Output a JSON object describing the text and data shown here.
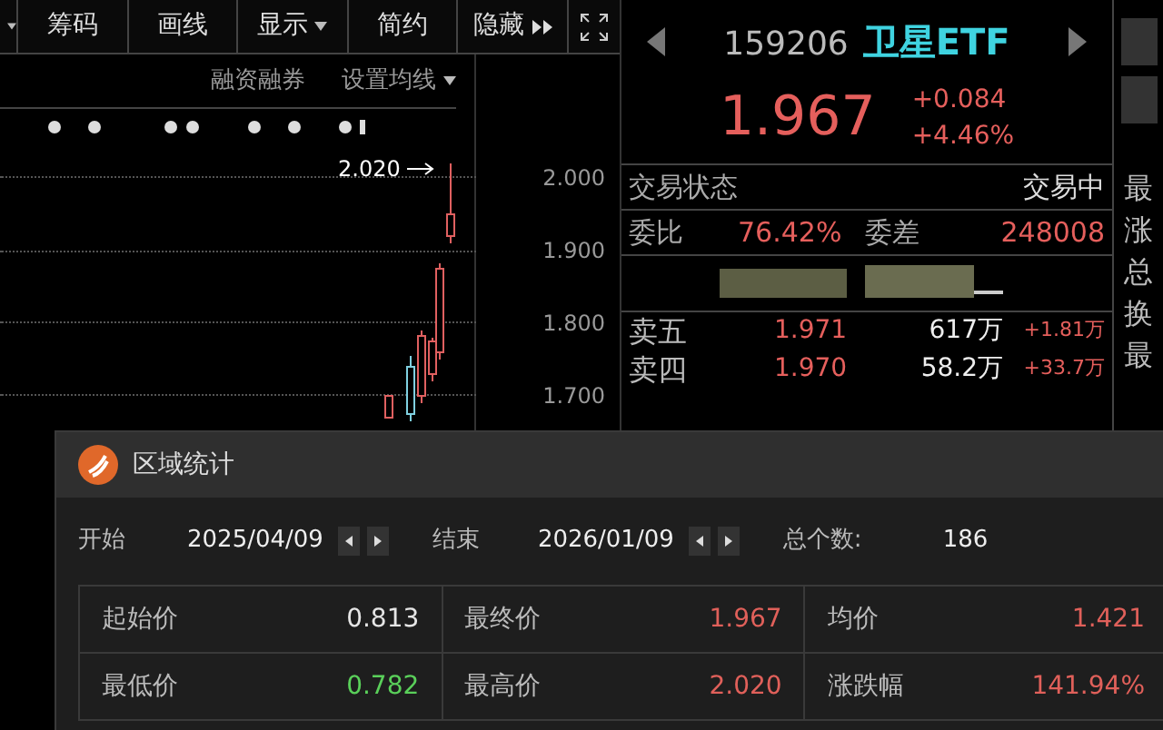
{
  "toolbar": {
    "tabs": [
      {
        "label": "筹码",
        "dropdown": false
      },
      {
        "label": "画线",
        "dropdown": false
      },
      {
        "label": "显示",
        "dropdown": true
      },
      {
        "label": "简约",
        "dropdown": false
      },
      {
        "label": "隐藏",
        "dropdown": false,
        "more": true
      }
    ]
  },
  "chart": {
    "links": [
      {
        "label": "融资融券",
        "dropdown": false
      },
      {
        "label": "设置均线",
        "dropdown": true
      }
    ],
    "high_label": "2.020",
    "axis_labels": [
      "2.000",
      "1.900",
      "1.800",
      "1.700"
    ]
  },
  "quote": {
    "code": "159206",
    "name": "卫星ETF",
    "price": "1.967",
    "change": "+0.084",
    "change_pct": "+4.46%",
    "status": {
      "label": "交易状态",
      "value": "交易中"
    },
    "ratio": {
      "label": "委比",
      "value": "76.42%",
      "diff_label": "委差",
      "diff_value": "248008"
    },
    "asks": [
      {
        "label": "卖五",
        "price": "1.971",
        "volume": "617万",
        "delta": "+1.81万"
      },
      {
        "label": "卖四",
        "price": "1.970",
        "volume": "58.2万",
        "delta": "+33.7万"
      }
    ]
  },
  "side_labels": [
    "最",
    "涨",
    "总",
    "换",
    "最"
  ],
  "dialog": {
    "title": "区域统计",
    "start_label": "开始",
    "start": "2025/04/09",
    "end_label": "结束",
    "end": "2026/01/09",
    "count_label": "总个数:",
    "count": "186",
    "stats": [
      {
        "label": "起始价",
        "value": "0.813",
        "color": "#e6e6e6"
      },
      {
        "label": "最终价",
        "value": "1.967",
        "color": "#e0605a"
      },
      {
        "label": "均价",
        "value": "1.421",
        "color": "#e0605a"
      },
      {
        "label": "最低价",
        "value": "0.782",
        "color": "#5ad05a"
      },
      {
        "label": "最高价",
        "value": "2.020",
        "color": "#e0605a"
      },
      {
        "label": "涨跌幅",
        "value": "141.94%",
        "color": "#e0605a"
      }
    ]
  }
}
